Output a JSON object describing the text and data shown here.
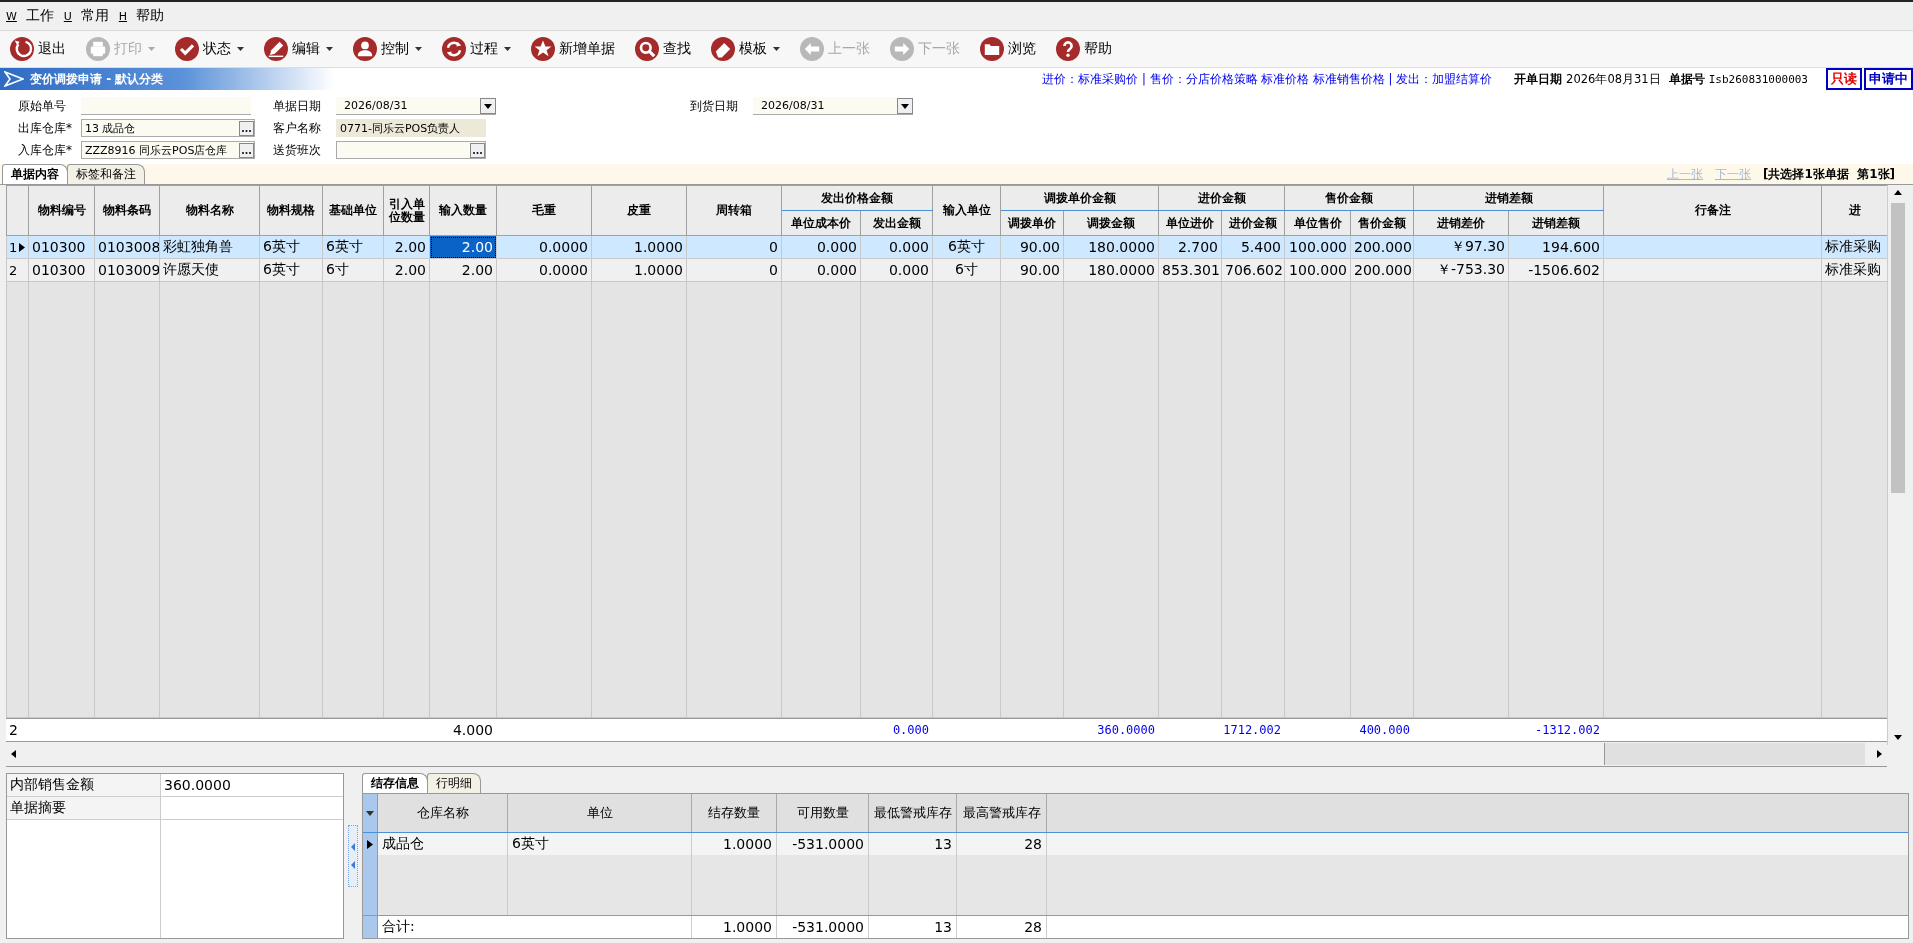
{
  "menu": [
    {
      "key": "W",
      "label": "工作"
    },
    {
      "key": "U",
      "label": "常用"
    },
    {
      "key": "H",
      "label": "帮助"
    }
  ],
  "toolbar": [
    {
      "label": "退出",
      "disabled": false,
      "dropdown": false
    },
    {
      "label": "打印",
      "disabled": true,
      "dropdown": true
    },
    {
      "label": "状态",
      "disabled": false,
      "dropdown": true
    },
    {
      "label": "编辑",
      "disabled": false,
      "dropdown": true
    },
    {
      "label": "控制",
      "disabled": false,
      "dropdown": true
    },
    {
      "label": "过程",
      "disabled": false,
      "dropdown": true
    },
    {
      "label": "新增单据",
      "disabled": false,
      "dropdown": false
    },
    {
      "label": "查找",
      "disabled": false,
      "dropdown": false
    },
    {
      "label": "模板",
      "disabled": false,
      "dropdown": true
    },
    {
      "label": "上一张",
      "disabled": true,
      "dropdown": false
    },
    {
      "label": "下一张",
      "disabled": true,
      "dropdown": false
    },
    {
      "label": "浏览",
      "disabled": false,
      "dropdown": false
    },
    {
      "label": "帮助",
      "disabled": false,
      "dropdown": false
    }
  ],
  "title": "变价调拨申请 - 默认分类",
  "price_info": "进价：标准采购价 | 售价：分店价格策略 标准价格 标准销售价格 | 发出：加盟结算价",
  "open_date": {
    "label": "开单日期",
    "value": "2026年08月31日"
  },
  "doc_no": {
    "label": "单据号",
    "value": "Isb260831000003"
  },
  "badges": [
    {
      "text": "只读",
      "color": "#e00000"
    },
    {
      "text": "申请中",
      "color": "#0000c0"
    }
  ],
  "form": [
    [
      {
        "label": "原始单号",
        "kind": "plain"
      },
      {
        "label": "出库仓库*",
        "value": "13 成品仓",
        "kind": "lookup"
      },
      {
        "label": "入库仓库*",
        "value": "ZZZ8916 同乐云POS店仓库",
        "kind": "lookup"
      }
    ],
    [
      {
        "label": "单据日期",
        "value": "2026/08/31",
        "kind": "date"
      },
      {
        "label": "客户名称",
        "value": "0771-同乐云POS负责人",
        "kind": "readonly"
      },
      {
        "label": "送货班次",
        "kind": "lookup"
      }
    ],
    [
      {
        "label": "到货日期",
        "value": "2026/08/31",
        "kind": "date"
      }
    ]
  ],
  "tabs": [
    {
      "label": "单据内容",
      "selected": true
    },
    {
      "label": "标签和备注",
      "selected": false
    }
  ],
  "nav": {
    "prev": {
      "label": "上一张",
      "disabled": true
    },
    "next": {
      "label": "下一张",
      "disabled": true
    },
    "summary": "[共选择1张单据  第1张]"
  },
  "grid": {
    "header": [
      {
        "label": "物料编号",
        "kind": "text",
        "focused": false
      },
      {
        "label": "物料条码",
        "kind": "text",
        "focused": false
      },
      {
        "label": "物料名称",
        "kind": "text",
        "focused": false
      },
      {
        "label": "物料规格",
        "kind": "text",
        "focused": false
      },
      {
        "label": "基础单位",
        "kind": "text",
        "focused": false
      },
      {
        "label": "引入单位数量",
        "kind": "number",
        "focused": false
      },
      {
        "label": "输入数量",
        "kind": "number",
        "focused": true,
        "total": "4.000"
      },
      {
        "label": "毛重",
        "kind": "number",
        "focused": false
      },
      {
        "label": "皮重",
        "kind": "number",
        "focused": false
      },
      {
        "label": "周转箱",
        "kind": "number",
        "focused": false
      },
      {
        "group": "发出价格金额",
        "columns": [
          {
            "label": "单位成本价",
            "kind": "number",
            "focused": false
          },
          {
            "label": "发出金额",
            "kind": "number",
            "focused": false,
            "total": "0.000"
          }
        ]
      },
      {
        "label": "输入单位",
        "kind": "center",
        "focused": false
      },
      {
        "group": "调拨单价金额",
        "columns": [
          {
            "label": "调拨单价",
            "kind": "number",
            "focused": false
          },
          {
            "label": "调拨金额",
            "kind": "number",
            "focused": false,
            "total": "360.0000"
          }
        ]
      },
      {
        "group": "进价金额",
        "columns": [
          {
            "label": "单位进价",
            "kind": "number",
            "focused": false
          },
          {
            "label": "进价金额",
            "kind": "number",
            "focused": false,
            "total": "1712.002"
          }
        ]
      },
      {
        "group": "售价金额",
        "columns": [
          {
            "label": "单位售价",
            "kind": "number",
            "focused": false
          },
          {
            "label": "售价金额",
            "kind": "number",
            "focused": false,
            "total": "400.000"
          }
        ]
      },
      {
        "group": "进销差额",
        "columns": [
          {
            "label": "进销差价",
            "kind": "number",
            "focused": false
          },
          {
            "label": "进销差额",
            "kind": "number",
            "focused": false,
            "total": "-1312.002"
          }
        ]
      },
      {
        "label": "行备注",
        "kind": "note",
        "focused": false
      },
      {
        "label": "进",
        "kind": "text",
        "focused": false
      }
    ],
    "rows": [
      {
        "number": "1",
        "current": true,
        "selected": true,
        "cells": [
          "010300",
          "0103008",
          "彩虹独角兽",
          "6英寸",
          "6英寸",
          "2.00",
          "2.00",
          "0.0000",
          "1.0000",
          "0",
          "0.000",
          "0.000",
          "6英寸",
          "90.00",
          "180.0000",
          "2.700",
          "5.400",
          "100.000",
          "200.000",
          "￥97.30",
          "194.600",
          "标准采购"
        ]
      },
      {
        "number": "2",
        "current": false,
        "selected": false,
        "cells": [
          "010300",
          "0103009",
          "许愿天使",
          "6英寸",
          "6寸",
          "2.00",
          "2.00",
          "0.0000",
          "1.0000",
          "0",
          "0.000",
          "0.000",
          "6寸",
          "90.00",
          "180.0000",
          "853.301",
          "706.602",
          "100.000",
          "200.000",
          "￥-753.30",
          "-1506.602",
          "标准采购"
        ]
      }
    ],
    "row_count": "2"
  },
  "summary": [
    {
      "label": "内部销售金额",
      "value": "360.0000"
    },
    {
      "label": "单据摘要"
    }
  ],
  "stock": {
    "tabs": [
      {
        "label": "结存信息",
        "selected": true
      },
      {
        "label": "行明细",
        "selected": false
      }
    ],
    "columns": [
      "仓库名称",
      "单位",
      "结存数量",
      "可用数量",
      "最低警戒库存",
      "最高警戒库存"
    ],
    "rows": [
      {
        "current": true,
        "cells": [
          "成品仓",
          "6英寸",
          "1.0000",
          "-531.0000",
          "13",
          "28"
        ]
      }
    ],
    "total": {
      "label": "合计:",
      "cells": [
        "1.0000",
        "-531.0000",
        "13",
        "28"
      ]
    }
  }
}
